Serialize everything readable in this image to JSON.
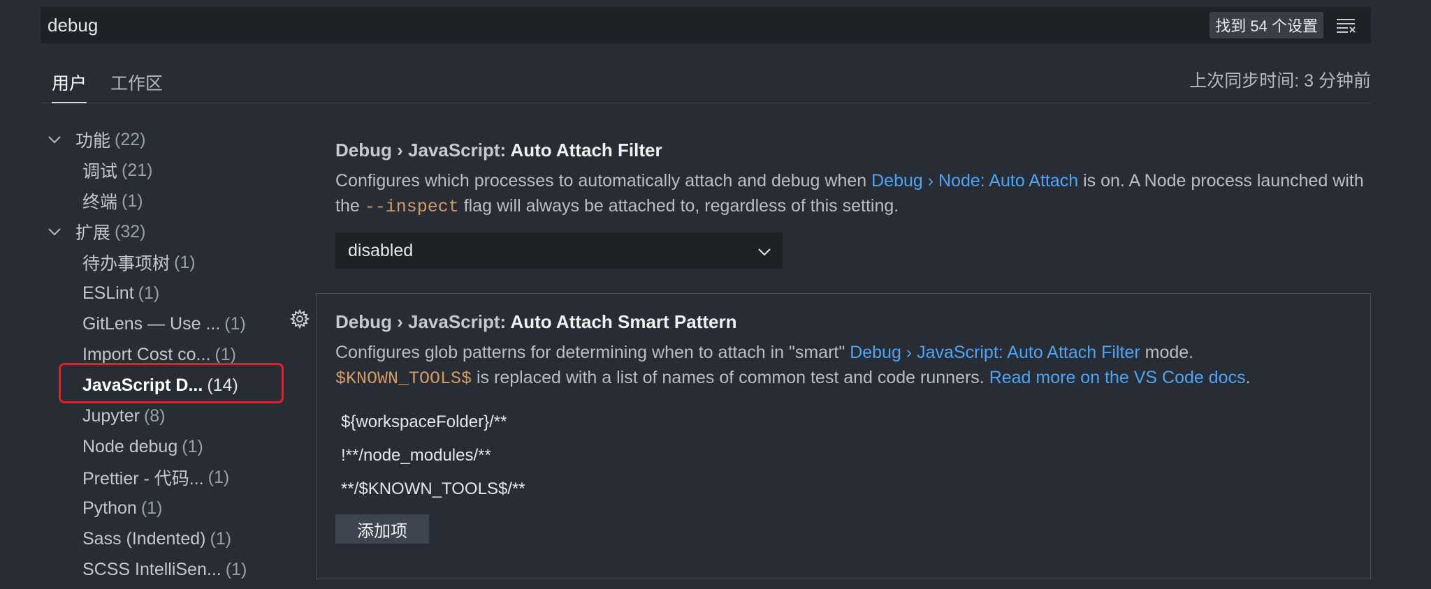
{
  "search": {
    "value": "debug",
    "result_count": "找到 54 个设置",
    "filter_icon": "clear-filter-icon"
  },
  "tabs": [
    {
      "label": "用户",
      "active": true
    },
    {
      "label": "工作区",
      "active": false
    }
  ],
  "sync_status": "上次同步时间: 3 分钟前",
  "tree": {
    "groups": [
      {
        "label": "功能",
        "count": "(22)",
        "expanded": true,
        "children": [
          {
            "label": "调试",
            "count": "(21)"
          },
          {
            "label": "终端",
            "count": "(1)"
          }
        ]
      },
      {
        "label": "扩展",
        "count": "(32)",
        "expanded": true,
        "children": [
          {
            "label": "待办事项树",
            "count": "(1)"
          },
          {
            "label": "ESLint",
            "count": "(1)"
          },
          {
            "label": "GitLens — Use ...",
            "count": "(1)"
          },
          {
            "label": "Import Cost co...",
            "count": "(1)"
          },
          {
            "label": "JavaScript D...",
            "count": "(14)",
            "selected": true
          },
          {
            "label": "Jupyter",
            "count": "(8)"
          },
          {
            "label": "Node debug",
            "count": "(1)"
          },
          {
            "label": "Prettier - 代码...",
            "count": "(1)"
          },
          {
            "label": "Python",
            "count": "(1)"
          },
          {
            "label": "Sass (Indented)",
            "count": "(1)"
          },
          {
            "label": "SCSS IntelliSen...",
            "count": "(1)"
          }
        ]
      }
    ]
  },
  "settings": [
    {
      "category": "Debug › JavaScript: ",
      "name": "Auto Attach Filter",
      "desc_part1": "Configures which processes to automatically attach and debug when ",
      "desc_link": "Debug › Node: Auto Attach",
      "desc_part2": " is on. A Node process launched with the ",
      "desc_code": "--inspect",
      "desc_part3": " flag will always be attached to, regardless of this setting.",
      "dropdown_value": "disabled"
    },
    {
      "category": "Debug › JavaScript: ",
      "name": "Auto Attach Smart Pattern",
      "desc_part1": "Configures glob patterns for determining when to attach in \"smart\" ",
      "desc_link": "Debug › JavaScript: Auto Attach Filter",
      "desc_part2": " mode.",
      "desc_code": "$KNOWN_TOOLS$",
      "desc_part3": " is replaced with a list of names of common test and code runners. ",
      "desc_link2": "Read more on the VS Code docs",
      "desc_part4": ".",
      "patterns": [
        "${workspaceFolder}/**",
        "!**/node_modules/**",
        "**/$KNOWN_TOOLS$/**"
      ],
      "add_button": "添加项"
    }
  ],
  "colors": {
    "background": "#282c34",
    "link": "#4ea4f5",
    "code": "#d19a66",
    "highlight": "#e0202a"
  }
}
